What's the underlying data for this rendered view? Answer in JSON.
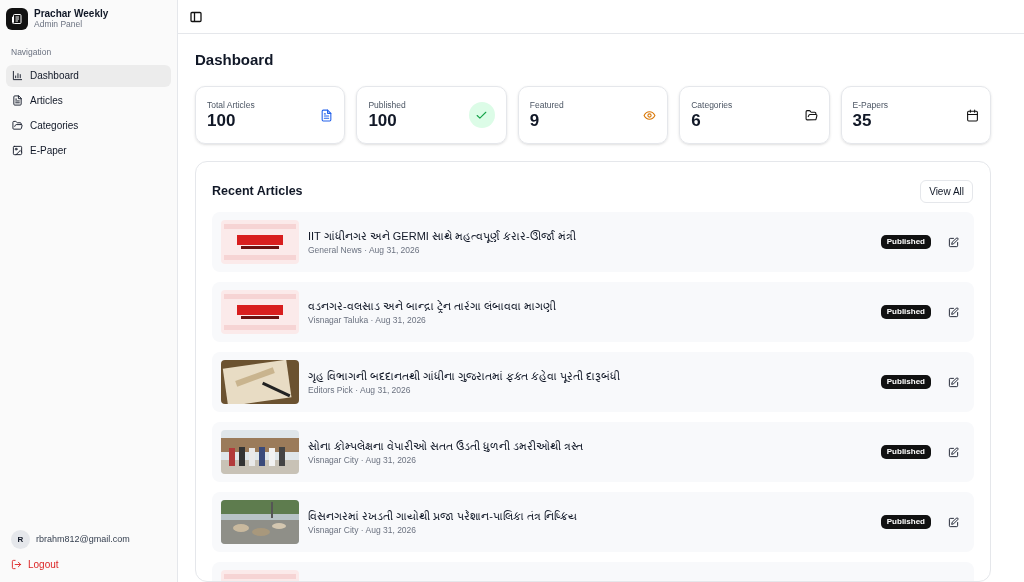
{
  "brand": {
    "title": "Prachar Weekly",
    "subtitle": "Admin Panel"
  },
  "sidebar": {
    "heading": "Navigation",
    "items": [
      {
        "label": "Dashboard",
        "selected": true
      },
      {
        "label": "Articles",
        "selected": false
      },
      {
        "label": "Categories",
        "selected": false
      },
      {
        "label": "E-Paper",
        "selected": false
      }
    ],
    "user": {
      "initial": "R",
      "email": "rbrahm812@gmail.com"
    },
    "logout": "Logout"
  },
  "page_title": "Dashboard",
  "stats": [
    {
      "label": "Total Articles",
      "value": "100"
    },
    {
      "label": "Published",
      "value": "100"
    },
    {
      "label": "Featured",
      "value": "9"
    },
    {
      "label": "Categories",
      "value": "6"
    },
    {
      "label": "E-Papers",
      "value": "35"
    }
  ],
  "recent": {
    "title": "Recent Articles",
    "view_all": "View All",
    "articles": [
      {
        "kind": "picture",
        "title": "IIT ગાંધીનગર અને GERMI સાથે મહત્વપૂર્ણ કરાર-ઊર્જા મંત્રી",
        "meta": "General News · Aug 31, 2026",
        "status": "Published"
      },
      {
        "kind": "picture",
        "title": "વડનગર-વલસાડ અને બાન્દ્રા ટ્રેન તારંગા લંબાવવા માગણી",
        "meta": "Visnagar Taluka · Aug 31, 2026",
        "status": "Published"
      },
      {
        "kind": "picture",
        "title": "ગૃહ વિભાગની બદદાનતથી ગાંધીના ગુજરાતમાં ફક્ત કહેવા પૂરતી દારૂબંધી",
        "meta": "Editors Pick · Aug 31, 2026",
        "status": "Published"
      },
      {
        "kind": "picture",
        "title": "સોના કોમ્પલેક્ષના વેપારીઓ સતત ઉડતી ધુળની ડમરીઓથી ત્રસ્ત",
        "meta": "Visnagar City · Aug 31, 2026",
        "status": "Published"
      },
      {
        "kind": "picture",
        "title": "વિસનગરમાં રખડતી ગાયોથી પ્રજા પરેશાન-પાલિકા તંત્ર નિષ્ક્રિય",
        "meta": "Visnagar City · Aug 31, 2026",
        "status": "Published"
      },
      {
        "kind": "picture"
      }
    ]
  }
}
